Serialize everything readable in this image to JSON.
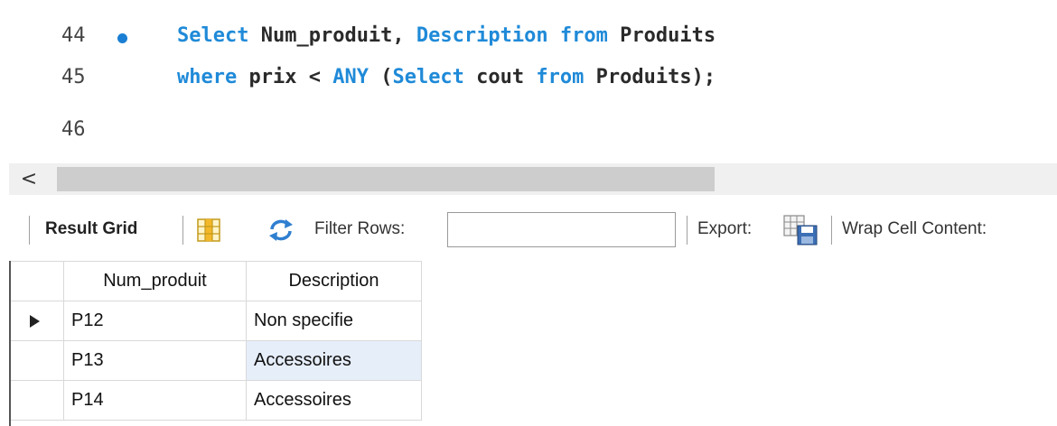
{
  "editor": {
    "lines": [
      {
        "number": "44",
        "tokens": [
          {
            "t": "Select",
            "kw": true
          },
          {
            "t": " Num_produit, ",
            "kw": false
          },
          {
            "t": "Description",
            "kw": true
          },
          {
            "t": " ",
            "kw": false
          },
          {
            "t": "from",
            "kw": true
          },
          {
            "t": " Produits",
            "kw": false
          }
        ]
      },
      {
        "number": "45",
        "tokens": [
          {
            "t": "where",
            "kw": true
          },
          {
            "t": " prix < ",
            "kw": false
          },
          {
            "t": "ANY",
            "kw": true
          },
          {
            "t": " (",
            "kw": false
          },
          {
            "t": "Select",
            "kw": true
          },
          {
            "t": " cout ",
            "kw": false
          },
          {
            "t": "from",
            "kw": true
          },
          {
            "t": " Produits);",
            "kw": false
          }
        ]
      },
      {
        "number": "46",
        "tokens": []
      }
    ],
    "keyword_color": "#1f8ad8",
    "text_color": "#2a2a2a",
    "exec_marker_color": "#1a7fd4"
  },
  "scrollbar": {
    "left_arrow": "<"
  },
  "toolbar": {
    "result_grid_label": "Result Grid",
    "filter_rows_label": "Filter Rows:",
    "filter_value": "",
    "export_label": "Export:",
    "wrap_label": "Wrap Cell Content:",
    "icons": [
      "grid-layout-icon",
      "refresh-icon",
      "export-icon"
    ]
  },
  "grid": {
    "columns": [
      "Num_produit",
      "Description"
    ],
    "rows": [
      {
        "cells": [
          "P12",
          "Non specifie"
        ],
        "current": true
      },
      {
        "cells": [
          "P13",
          "Accessoires"
        ],
        "current": false
      },
      {
        "cells": [
          "P14",
          "Accessoires"
        ],
        "current": false
      }
    ],
    "selected_cell_color": "#e6eefa"
  }
}
